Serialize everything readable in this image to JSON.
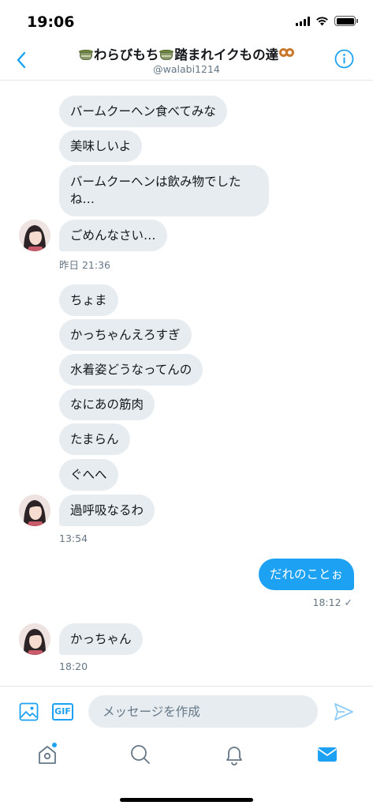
{
  "status_bar": {
    "time": "19:06"
  },
  "header": {
    "title_part1": "わらびもち",
    "title_part2": "踏まれイクもの達",
    "handle": "@walabi1214"
  },
  "messages": [
    {
      "type": "in",
      "text": "バームクーヘン食べてみな"
    },
    {
      "type": "in",
      "text": "美味しいよ"
    },
    {
      "type": "in",
      "text": "バームクーヘンは飲み物でしたね…"
    },
    {
      "type": "in",
      "text": "ごめんなさい…"
    },
    {
      "type": "timestamp",
      "text": "昨日 21:36"
    },
    {
      "type": "in",
      "text": "ちょま"
    },
    {
      "type": "in",
      "text": "かっちゃんえろすぎ"
    },
    {
      "type": "in",
      "text": "水着姿どうなってんの"
    },
    {
      "type": "in",
      "text": "なにあの筋肉"
    },
    {
      "type": "in",
      "text": "たまらん"
    },
    {
      "type": "in",
      "text": "ぐへへ"
    },
    {
      "type": "in",
      "text": "過呼吸なるわ"
    },
    {
      "type": "timestamp",
      "text": "13:54"
    },
    {
      "type": "out",
      "text": "だれのことぉ"
    },
    {
      "type": "timestamp",
      "text": "18:12 ✓"
    },
    {
      "type": "in",
      "text": "かっちゃん"
    },
    {
      "type": "timestamp",
      "text": "18:20"
    }
  ],
  "composer": {
    "gif_label": "GIF",
    "placeholder": "メッセージを作成"
  },
  "tabs": [
    {
      "icon": "home-icon",
      "active": false,
      "has_dot": true
    },
    {
      "icon": "search-icon",
      "active": false
    },
    {
      "icon": "bell-icon",
      "active": false
    },
    {
      "icon": "mail-icon",
      "active": true
    }
  ],
  "colors": {
    "accent": "#1da1f2",
    "incoming_bubble": "#e6ecf0",
    "secondary_text": "#657786"
  }
}
